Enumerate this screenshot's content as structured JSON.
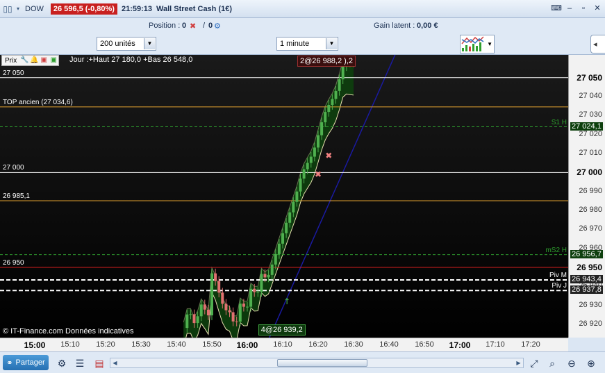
{
  "titlebar": {
    "symbol": "DOW",
    "price_badge": "26 596,5 (-0,80%)",
    "time": "21:59:13",
    "instrument": "Wall Street Cash (1€)"
  },
  "position_bar": {
    "position_label": "Position :",
    "position_value": "0",
    "separator": "/",
    "position_value2": "0",
    "gain_label": "Gain latent :",
    "gain_value": "0,00 €"
  },
  "toolbar": {
    "units": "200 unités",
    "interval": "1 minute"
  },
  "chart_toolbar": {
    "label": "Prix",
    "info": "Jour :+Haut 27 180,0 +Bas 26 548,0"
  },
  "chart_data": {
    "type": "candlestick",
    "ylim": [
      26913,
      27062
    ],
    "x_ticks": [
      "15:00",
      "15:10",
      "15:20",
      "15:30",
      "15:40",
      "15:50",
      "16:00",
      "16:10",
      "16:20",
      "16:30",
      "16:40",
      "16:50",
      "17:00",
      "17:10",
      "17:20"
    ],
    "x_ticks_bold": [
      "15:00",
      "16:00",
      "17:00"
    ],
    "y_ticks": [
      "27 050",
      "27 040",
      "27 030",
      "27 020",
      "27 010",
      "27 000",
      "26 990",
      "26 980",
      "26 970",
      "26 960",
      "26 950",
      "26 940",
      "26 930",
      "26 920"
    ],
    "y_ticks_bold": [
      "27 050",
      "27 000",
      "26 950"
    ],
    "levels": [
      {
        "label": "27 050",
        "value": 27050,
        "color": "#ffffff",
        "style": "solid"
      },
      {
        "label": "TOP ancien  (27 034,6)",
        "value": 27034.6,
        "color": "#e0a030",
        "style": "solid"
      },
      {
        "label": "S1 H",
        "value": 27024.1,
        "tag": "27 024,1",
        "color": "#2e9e2e",
        "style": "dashed"
      },
      {
        "label": "27 000",
        "value": 27000,
        "color": "#ffffff",
        "style": "solid"
      },
      {
        "label": "26 985,1",
        "value": 26985.1,
        "color": "#e0a030",
        "style": "solid"
      },
      {
        "label": "mS2 H",
        "value": 26956.7,
        "tag": "26 956,7",
        "color": "#2e9e2e",
        "style": "dashed"
      },
      {
        "label": "26 950",
        "value": 26950,
        "color": "#e02020",
        "style": "solid"
      },
      {
        "label": "Piv M",
        "value": 26943.4,
        "tag": "26 943,4",
        "color": "#ffffff",
        "style": "dashed"
      },
      {
        "label": "Piv J",
        "value": 26937.8,
        "tag": "26 937,8",
        "color": "#ffffff",
        "style": "dashed"
      }
    ],
    "annotations": [
      {
        "text": "2@26 988,2 ),2",
        "time": "16:20"
      },
      {
        "text": "4@26 939,2",
        "time": "16:07"
      }
    ],
    "watermark": "© IT-Finance.com  Données indicatives"
  },
  "colors": {
    "up": "#4fb04f",
    "down": "#e07070",
    "band_fill": "#0d3f0d",
    "band_edge": "#e8e0b0",
    "ma_line": "#1a1aa0"
  },
  "bottombar": {
    "share_label": "Partager"
  }
}
